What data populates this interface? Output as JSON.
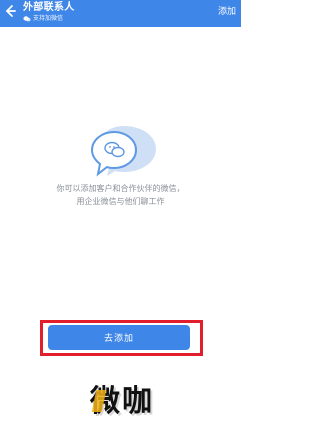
{
  "colors": {
    "accent": "#3e86e8",
    "highlight": "#e21d2c",
    "text_muted": "#8a8f96"
  },
  "appbar": {
    "back_icon": "arrow-left-icon",
    "title": "外部联系人",
    "subtitle": "支持加微信",
    "subtitle_icon": "wechat-icon",
    "add_label": "添加"
  },
  "main": {
    "illustration_icon": "wechat-bubbles-icon",
    "description_line1": "你可以添加客户和合作伙伴的微信，",
    "description_line2": "用企业微信与他们聊工作",
    "add_button_label": "去添加"
  },
  "watermark": {
    "text": "微咖"
  }
}
